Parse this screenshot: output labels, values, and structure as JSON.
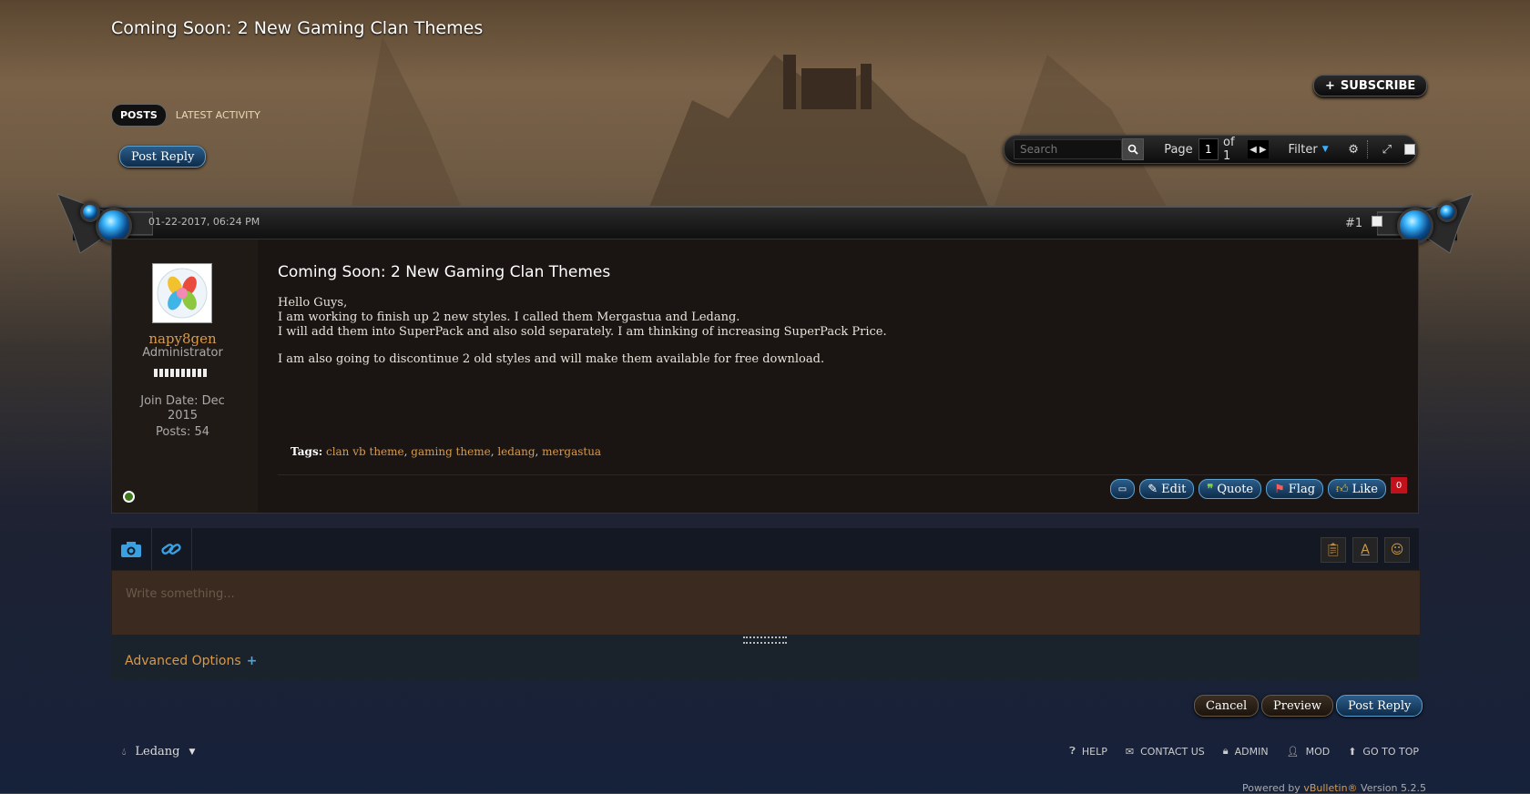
{
  "thread": {
    "title": "Coming Soon: 2 New Gaming Clan Themes",
    "subscribe_label": "SUBSCRIBE"
  },
  "tabs": [
    {
      "label": "POSTS",
      "active": true
    },
    {
      "label": "LATEST ACTIVITY",
      "active": false
    }
  ],
  "post_reply_top": "Post Reply",
  "toolbar": {
    "search_placeholder": "Search",
    "page_label": "Page",
    "page_current": "1",
    "page_total": "of 1",
    "filter_label": "Filter"
  },
  "post": {
    "date": "01-22-2017, 06:24 PM",
    "number": "#1",
    "title": "Coming Soon: 2 New Gaming Clan Themes",
    "lines": [
      "Hello Guys,",
      "I am working to finish up 2 new styles. I called them Mergastua and Ledang.",
      "I will add them into SuperPack and also sold separately. I am thinking of increasing SuperPack Price.",
      "",
      "I am also going to discontinue 2 old styles and will make them available for free download."
    ],
    "tags_label": "Tags:",
    "tags": [
      "clan vb theme",
      "gaming theme",
      "ledang",
      "mergastua"
    ],
    "actions": {
      "edit": "Edit",
      "quote": "Quote",
      "flag": "Flag",
      "like": "Like"
    },
    "like_count": "0"
  },
  "user": {
    "name": "napy8gen",
    "title": "Administrator",
    "join_date": "Join Date: Dec 2015",
    "posts": "Posts: 54"
  },
  "editor": {
    "placeholder": "Write something...",
    "advanced_label": "Advanced Options"
  },
  "buttons": {
    "cancel": "Cancel",
    "preview": "Preview",
    "post_reply": "Post Reply"
  },
  "footer": {
    "style_name": "Ledang",
    "links": [
      "HELP",
      "CONTACT US",
      "ADMIN",
      "MOD",
      "GO TO TOP"
    ],
    "powered_prefix": "Powered by ",
    "powered_brand": "vBulletin®",
    "powered_suffix": " Version 5.2.5"
  },
  "colors": {
    "accent_orange": "#d89a4a",
    "button_blue": "#2b5d8a",
    "like_badge": "#c1121b"
  }
}
